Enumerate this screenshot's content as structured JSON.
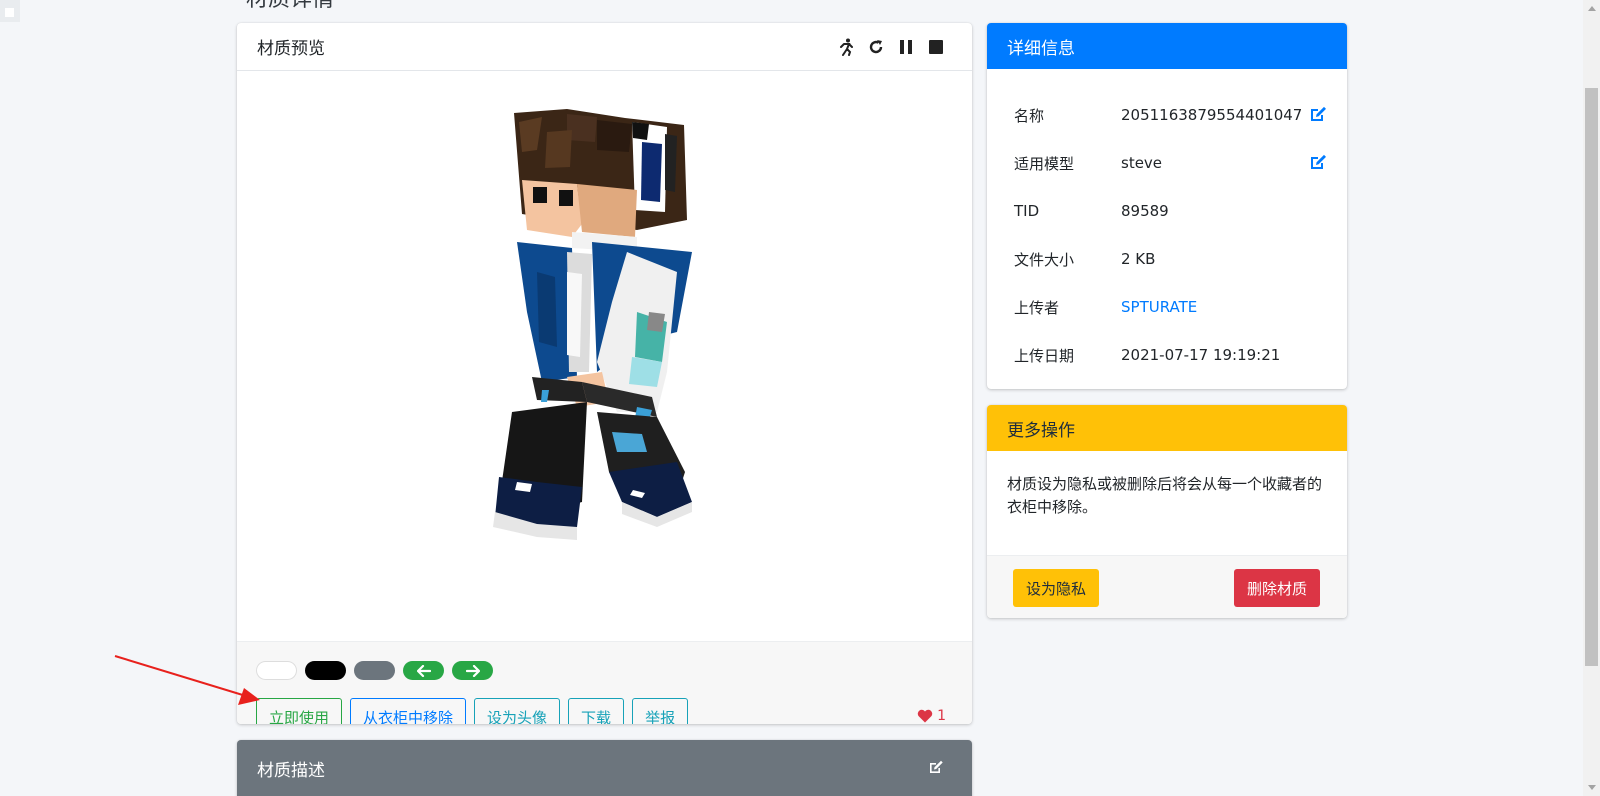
{
  "page": {
    "heading": "材质详情"
  },
  "preview": {
    "title": "材质预览",
    "tools": [
      "run-icon",
      "rotate-icon",
      "pause-icon",
      "stop-icon"
    ],
    "backgrounds": [
      "white",
      "black",
      "gray",
      "previous",
      "next"
    ],
    "actions": {
      "use_now": "立即使用",
      "remove_closet": "从衣柜中移除",
      "set_avatar": "设为头像",
      "download": "下载",
      "report": "举报"
    },
    "likes": "1"
  },
  "description": {
    "title": "材质描述"
  },
  "details": {
    "title": "详细信息",
    "rows": [
      {
        "key": "名称",
        "value": "2051163879554401047"
      },
      {
        "key": "适用模型",
        "value": "steve"
      },
      {
        "key": "TID",
        "value": "89589"
      },
      {
        "key": "文件大小",
        "value": "2 KB"
      },
      {
        "key": "上传者",
        "value": "SPTURATE"
      },
      {
        "key": "上传日期",
        "value": "2021-07-17 19:19:21"
      }
    ]
  },
  "more": {
    "title": "更多操作",
    "text": "材质设为隐私或被删除后将会从每一个收藏者的衣柜中移除。",
    "private_label": "设为隐私",
    "delete_label": "删除材质"
  },
  "colors": {
    "primary": "#007bff",
    "warning": "#ffc107",
    "danger": "#dc3545",
    "success": "#28a745",
    "info": "#17a2b8",
    "secondary": "#6c757d"
  }
}
